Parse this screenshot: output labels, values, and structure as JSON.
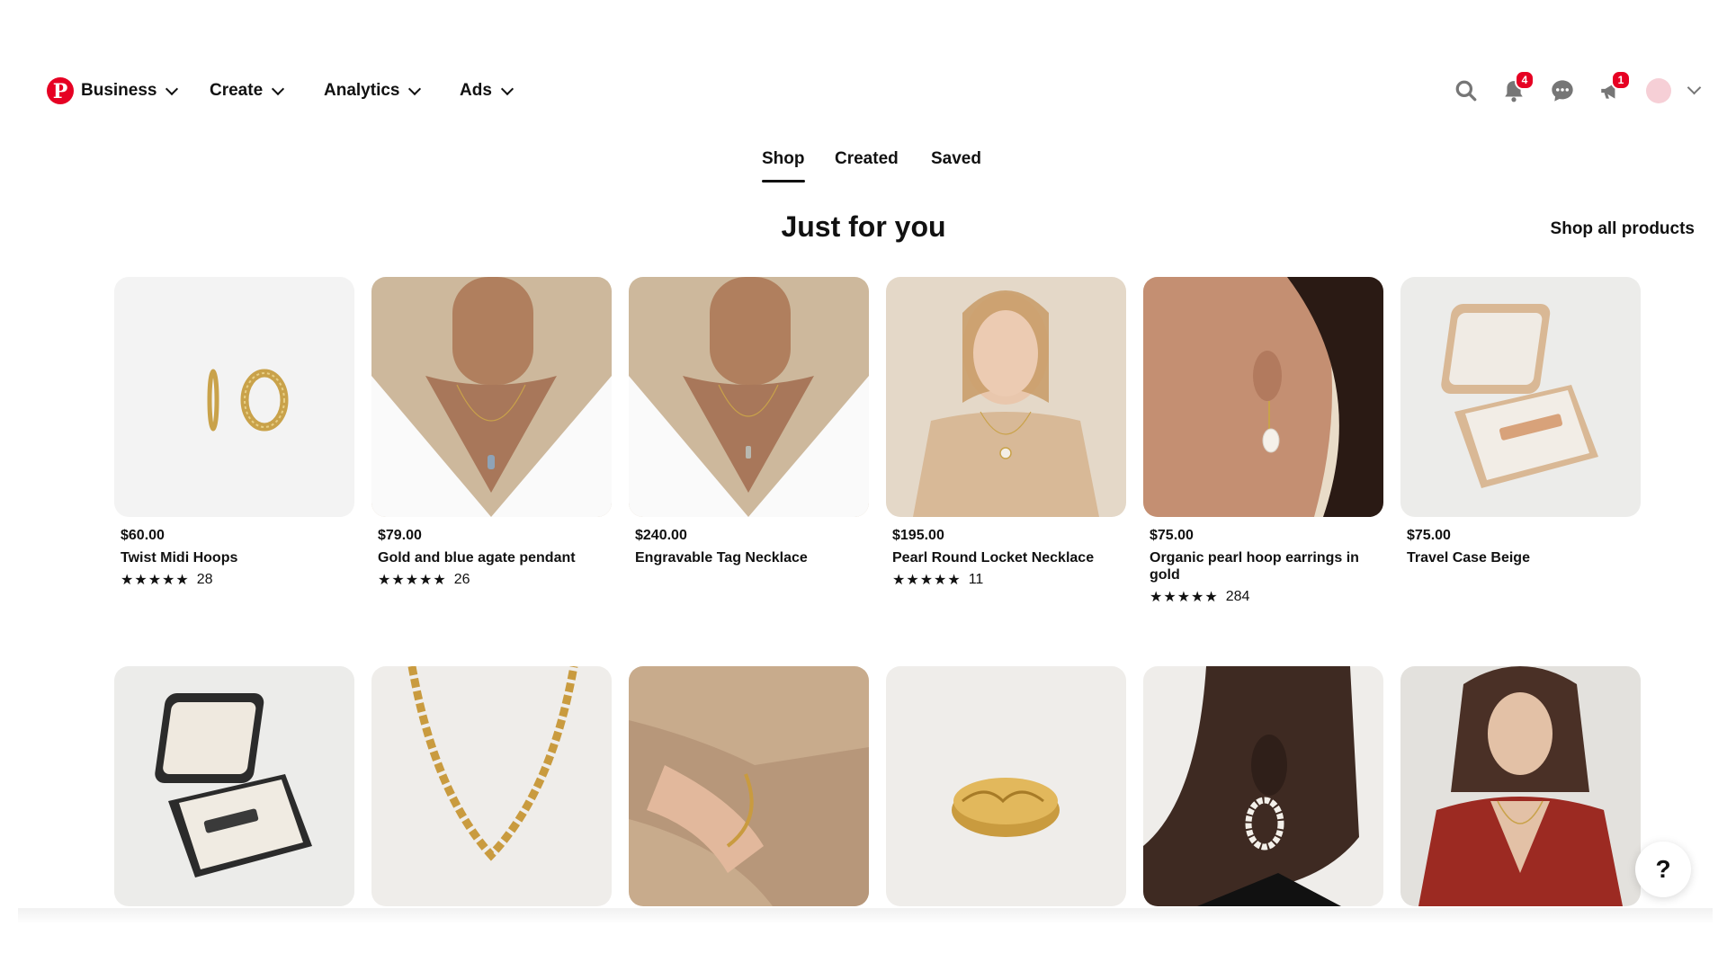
{
  "nav": {
    "logo_letter": "P",
    "business": "Business",
    "create": "Create",
    "analytics": "Analytics",
    "ads": "Ads",
    "notifications_count": "4",
    "updates_count": "1"
  },
  "tabs": [
    "Shop",
    "Created",
    "Saved"
  ],
  "section": {
    "heading": "Just for you",
    "shop_all": "Shop all products"
  },
  "products": [
    {
      "price": "$60.00",
      "title": "Twist Midi Hoops",
      "stars": "★★★★★",
      "rating_count": "28",
      "rating_value": 5
    },
    {
      "price": "$79.00",
      "title": "Gold and blue agate pendant",
      "stars": "★★★★★",
      "rating_count": "26",
      "rating_value": 5
    },
    {
      "price": "$240.00",
      "title": "Engravable Tag Necklace",
      "stars": "",
      "rating_count": ""
    },
    {
      "price": "$195.00",
      "title": "Pearl Round Locket Necklace",
      "stars": "★★★★★",
      "rating_count": "11",
      "rating_value": 4.5
    },
    {
      "price": "$75.00",
      "title": "Organic pearl hoop earrings in gold",
      "stars": "★★★★★",
      "rating_count": "284",
      "rating_value": 4.5
    },
    {
      "price": "$75.00",
      "title": "Travel Case Beige",
      "stars": "",
      "rating_count": ""
    }
  ],
  "help_label": "?",
  "colors": {
    "brand": "#e60023"
  }
}
